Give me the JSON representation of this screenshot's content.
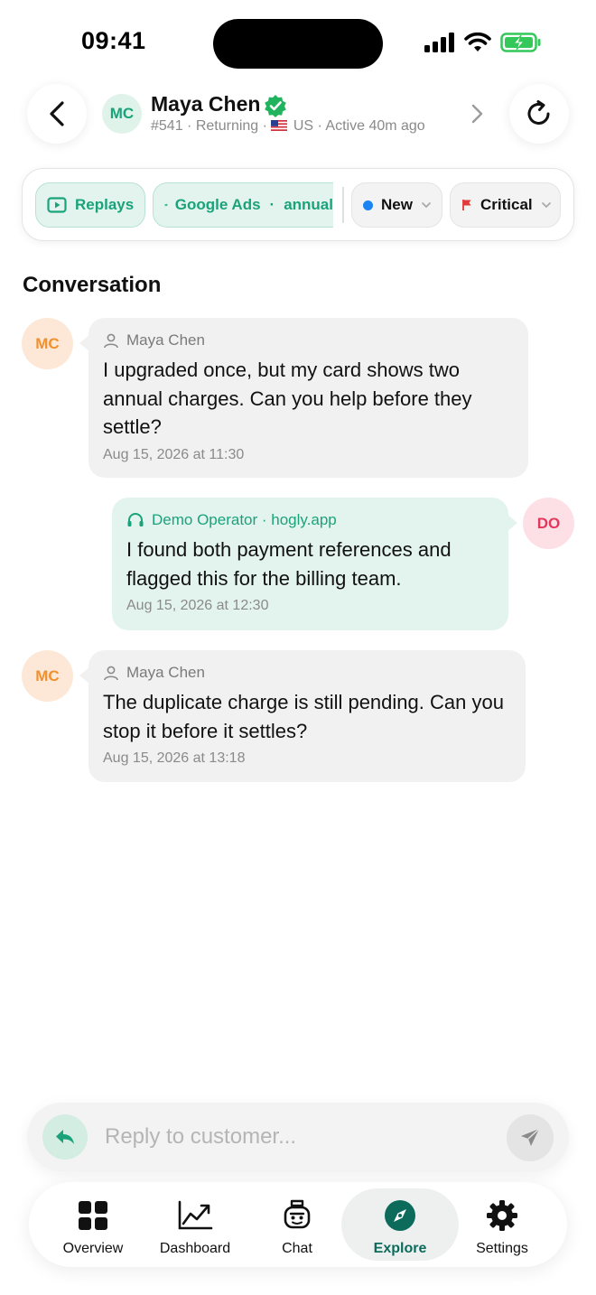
{
  "status_bar": {
    "time": "09:41"
  },
  "header": {
    "avatar_initials": "MC",
    "name": "Maya Chen",
    "meta_prefix": "#541 · Returning · ",
    "meta_suffix": "US · Active 40m ago"
  },
  "chips": {
    "replays": "Replays",
    "ads_source": "Google Ads",
    "ads_separator": "·",
    "ads_campaign": "annual",
    "status": "New",
    "priority": "Critical"
  },
  "conversation": {
    "title": "Conversation",
    "messages": [
      {
        "avatar": "MC",
        "sender": "Maya Chen",
        "text": "I upgraded once, but my card shows two annual charges. Can you help before they settle?",
        "time": "Aug 15, 2026 at 11:30"
      },
      {
        "avatar": "DO",
        "sender": "Demo Operator · hogly.app",
        "text": "I found both payment references and flagged this for the billing team.",
        "time": "Aug 15, 2026 at 12:30"
      },
      {
        "avatar": "MC",
        "sender": "Maya Chen",
        "text": "The duplicate charge is still pending. Can you stop it before it settles?",
        "time": "Aug 15, 2026 at 13:18"
      }
    ]
  },
  "reply": {
    "placeholder": "Reply to customer..."
  },
  "tabs": [
    {
      "label": "Overview",
      "icon": "grid-icon"
    },
    {
      "label": "Dashboard",
      "icon": "trend-chart-icon"
    },
    {
      "label": "Chat",
      "icon": "robot-icon"
    },
    {
      "label": "Explore",
      "icon": "compass-icon",
      "active": true
    },
    {
      "label": "Settings",
      "icon": "gear-icon"
    }
  ],
  "colors": {
    "accent_green": "#1aa37a",
    "explore_active": "#0d6b5c",
    "status_blue": "#1b84f2",
    "priority_red": "#e23a3a",
    "customer_avatar": "#f0912e",
    "operator_avatar": "#e2385c"
  }
}
